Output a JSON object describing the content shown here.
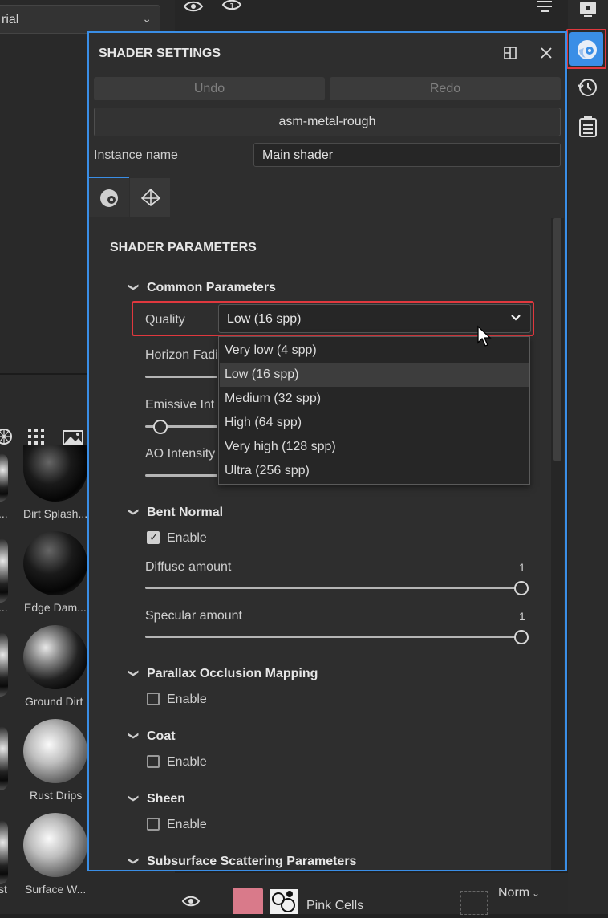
{
  "material_dropdown": {
    "value": "rial"
  },
  "library": {
    "thumbnails": [
      "Dirt Splash...",
      "Edge Dam...",
      "Ground Dirt",
      "Rust Drips",
      "Surface W..."
    ],
    "left_labels": [
      "...",
      "...",
      "st"
    ]
  },
  "layer_row": {
    "name": "Pink Cells",
    "blend": "Norm"
  },
  "dialog": {
    "title": "SHADER SETTINGS",
    "undo": "Undo",
    "redo": "Redo",
    "shader_name": "asm-metal-rough",
    "instance_label": "Instance name",
    "instance_value": "Main shader",
    "params_title": "SHADER PARAMETERS",
    "sections": {
      "common": "Common Parameters",
      "bent_normal": "Bent Normal",
      "parallax": "Parallax Occlusion Mapping",
      "coat": "Coat",
      "sheen": "Sheen",
      "subsurface": "Subsurface Scattering Parameters"
    },
    "quality_label": "Quality",
    "quality_value": "Low (16 spp)",
    "quality_options": [
      "Very low (4 spp)",
      "Low (16 spp)",
      "Medium (32 spp)",
      "High (64 spp)",
      "Very high (128 spp)",
      "Ultra (256 spp)"
    ],
    "hidden_labels": {
      "horizon": "Horizon Fadi",
      "emissive": "Emissive Int",
      "ao": "AO Intensity"
    },
    "enable": "Enable",
    "bent_normal_enabled": true,
    "diffuse": {
      "label": "Diffuse amount",
      "value": "1"
    },
    "specular": {
      "label": "Specular amount",
      "value": "1"
    },
    "parallax_enabled": false,
    "coat_enabled": false,
    "sheen_enabled": false
  },
  "colors": {
    "accent": "#3a8ee6",
    "highlight": "#e0383e",
    "panel": "#2e2e2e"
  }
}
